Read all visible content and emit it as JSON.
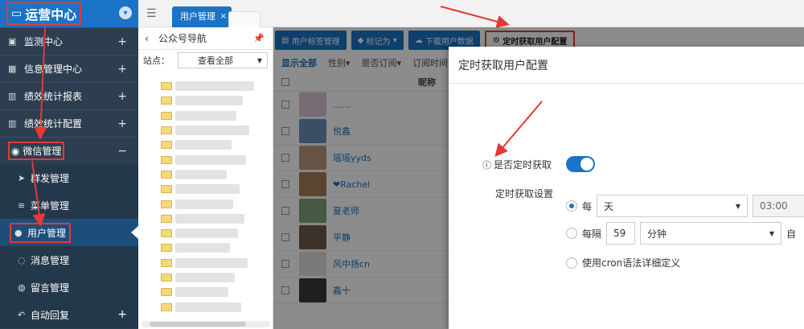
{
  "sidebar": {
    "title": "运营中心",
    "menu": [
      {
        "label": "监测中心"
      },
      {
        "label": "信息管理中心"
      },
      {
        "label": "绩效统计报表"
      },
      {
        "label": "绩效统计配置"
      },
      {
        "label": "微信管理",
        "expand": "−"
      }
    ],
    "plus": "+",
    "submenu": [
      {
        "label": "群发管理"
      },
      {
        "label": "菜单管理"
      },
      {
        "label": "用户管理"
      },
      {
        "label": "消息管理"
      },
      {
        "label": "留言管理"
      },
      {
        "label": "自动回复"
      }
    ]
  },
  "topbar": {
    "tab_label": "用户管理",
    "tab_close": "×"
  },
  "nav": {
    "title": "公众号导航",
    "site_label": "站点：",
    "site_value": "查看全部"
  },
  "main": {
    "toolbar": {
      "tags": "用户标签管理",
      "mark": "标记为",
      "download": "下载用户数据",
      "schedule": "定时获取用户配置"
    },
    "filters": {
      "all": "显示全部",
      "gender": "性别",
      "subscribed": "是否订阅",
      "subscribe_time": "订阅时间"
    },
    "list_header_nick": "昵称",
    "rows": [
      {
        "name": "……",
        "color": "#d9c4d8"
      },
      {
        "name": "悦鑫",
        "color": "#6b8fb8"
      },
      {
        "name": "瑶瑶yyds",
        "color": "#b89a7a"
      },
      {
        "name": "❤Rachel",
        "color": "#a57f5a"
      },
      {
        "name": "夏老师",
        "color": "#7fa37a"
      },
      {
        "name": "平静",
        "color": "#6e5b4c"
      },
      {
        "name": "风中扬cn",
        "color": "#dddddd"
      },
      {
        "name": "鑫十",
        "color": "#3a3a3a"
      }
    ]
  },
  "modal": {
    "title": "定时获取用户配置",
    "enable_label": "是否定时获取",
    "schedule_label": "定时获取设置",
    "every_label": "每",
    "unit_value": "天",
    "time_value": "03:00",
    "interval_label": "每隔",
    "interval_value": "59",
    "interval_unit": "分钟",
    "interval_suffix": "自",
    "cron_label": "使用cron语法详细定义"
  }
}
